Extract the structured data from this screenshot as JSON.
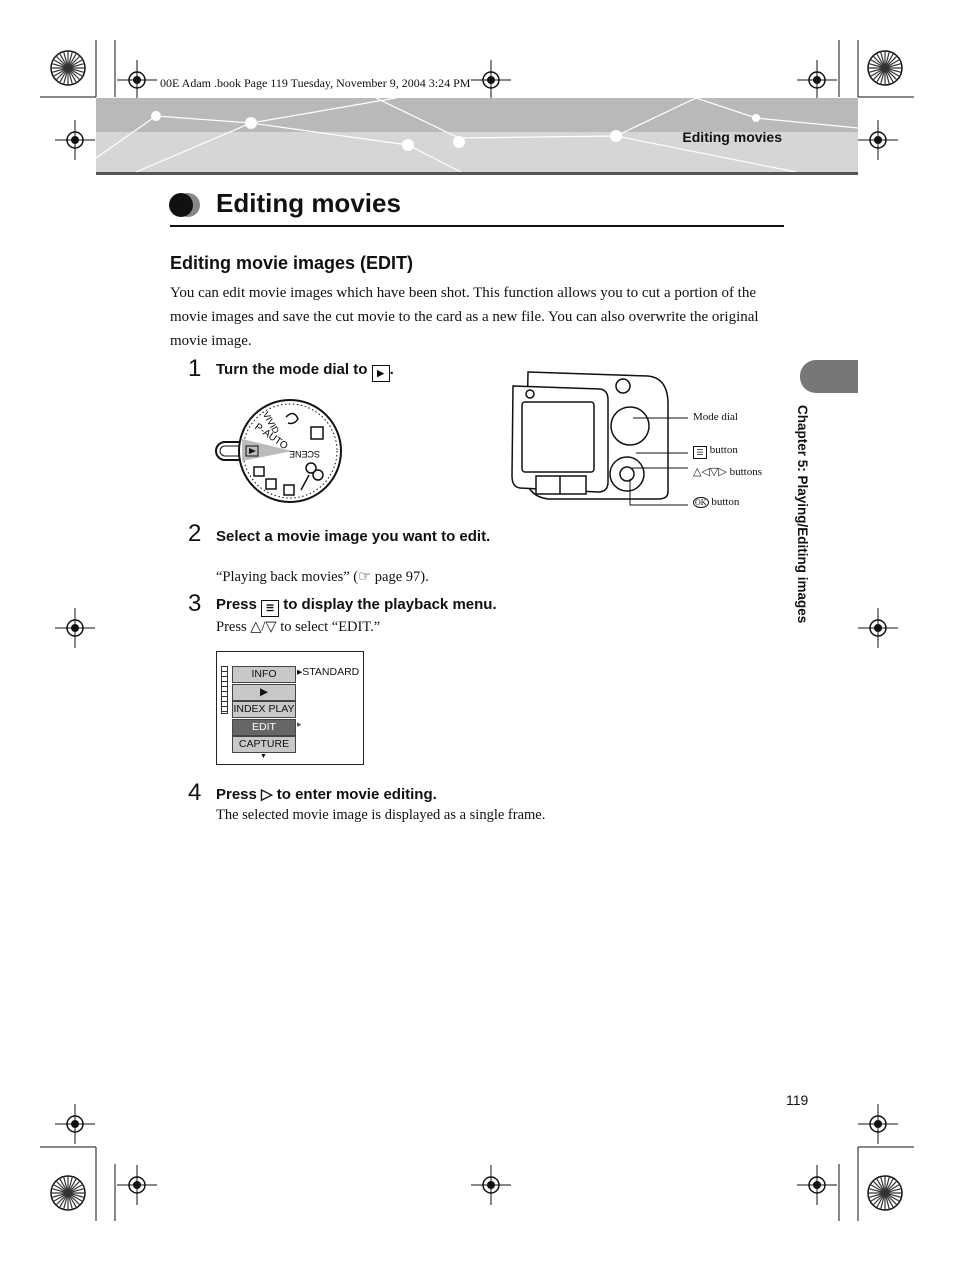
{
  "print_meta": "00E Adam .book  Page 119  Tuesday, November 9, 2004  3:24 PM",
  "header": {
    "section": "Editing movies"
  },
  "page_title": "Editing movies",
  "section_heading": "Editing movie images (EDIT)",
  "intro": "You can edit movie images which have been shot. This function allows you to cut a portion of the movie images and save the cut movie to the card as a new file. You can also overwrite the original movie image.",
  "steps": [
    {
      "num": "1",
      "text_before": "Turn the mode dial to",
      "icon": "play-icon",
      "text_after": "."
    },
    {
      "num": "2",
      "text": "Select a movie image you want to edit.",
      "sub": "“Playing back movies” (",
      "sub_ref": "page 97)."
    },
    {
      "num": "3",
      "text_before": "Press",
      "icon": "menu-icon",
      "text_after": "to display the playback menu.",
      "sub_before": "Press",
      "sub_after": "to select “EDIT.”"
    },
    {
      "num": "4",
      "text_before": "Press",
      "icon": "right-arrow-button-icon",
      "text_after": "to enter movie editing.",
      "sub": "The selected movie image is displayed as a single frame."
    }
  ],
  "mode_dial": {
    "labels": [
      "VIVID",
      "P-AUTO",
      "SCENE"
    ]
  },
  "camera_labels": {
    "mode_dial": "Mode dial",
    "menu_button": "button",
    "arrow_buttons": "buttons",
    "ok_button": "button"
  },
  "menu_screen": {
    "items": [
      "INFO",
      "",
      "INDEX PLAY",
      "EDIT",
      "CAPTURE"
    ],
    "selected": "EDIT",
    "info_value": "STANDARD"
  },
  "side_tab": "Chapter 5: Playing/Editing images",
  "page_number": "119"
}
